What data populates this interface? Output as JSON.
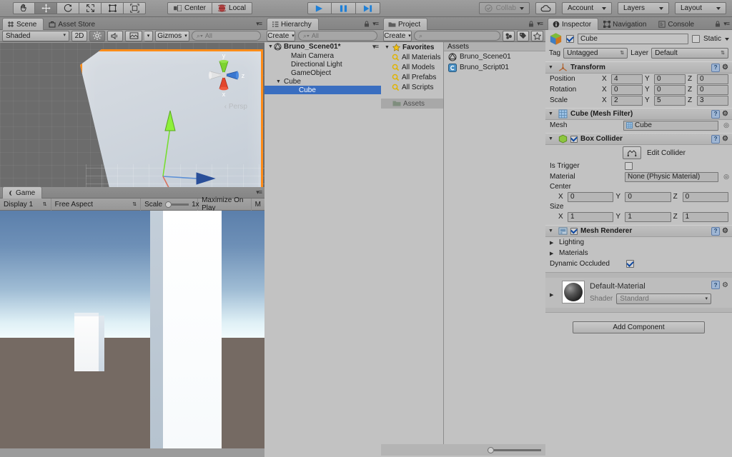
{
  "app": {
    "name": "Unity Editor"
  },
  "toolbar": {
    "tools": [
      {
        "name": "hand-tool",
        "glyph": "✋",
        "active": false
      },
      {
        "name": "move-tool",
        "glyph": "✥",
        "active": true
      },
      {
        "name": "rotate-tool",
        "glyph": "↻",
        "active": false
      },
      {
        "name": "scale-tool",
        "glyph": "⤢",
        "active": false
      },
      {
        "name": "rect-tool",
        "glyph": "□",
        "active": false
      },
      {
        "name": "transform-tool",
        "glyph": "⬚",
        "active": false
      }
    ],
    "pivot_label": "Center",
    "space_label": "Local",
    "play_label": "▶",
    "pause_label": "❙❙",
    "step_label": "▶❙",
    "collab_label": "Collab",
    "cloud_label": "☁",
    "account_label": "Account",
    "layers_label": "Layers",
    "layout_label": "Layout"
  },
  "scene": {
    "tab_label": "Scene",
    "asset_store_tab": "Asset Store",
    "shading_mode": "Shaded",
    "two_d_label": "2D",
    "lighting_icon": "light-icon",
    "audio_icon": "audio-icon",
    "effects_icon": "image-icon",
    "gizmos_label": "Gizmos",
    "search_placeholder": "All",
    "gizmo_axes": {
      "x": "x",
      "y": "y",
      "z": "z"
    },
    "persp_label": "Persp",
    "outline_color": "#ff8c19"
  },
  "game": {
    "tab_label": "Game",
    "display_label": "Display 1",
    "aspect_label": "Free Aspect",
    "scale_label": "Scale",
    "scale_value": "1x",
    "maximize_label": "Maximize On Play",
    "mute_label": "M",
    "sky_top_color": "#5b7fab",
    "ground_color": "#756a63"
  },
  "hierarchy": {
    "tab_label": "Hierarchy",
    "create_label": "Create",
    "search_placeholder": "All",
    "scene_name": "Bruno_Scene01*",
    "items": [
      {
        "label": "Main Camera",
        "depth": 2,
        "foldout": "",
        "selected": false
      },
      {
        "label": "Directional Light",
        "depth": 2,
        "foldout": "",
        "selected": false
      },
      {
        "label": "GameObject",
        "depth": 2,
        "foldout": "",
        "selected": false
      },
      {
        "label": "Cube",
        "depth": 1,
        "foldout": "▼",
        "selected": false
      },
      {
        "label": "Cube",
        "depth": 3,
        "foldout": "",
        "selected": true
      }
    ]
  },
  "project": {
    "tab_label": "Project",
    "create_label": "Create",
    "search_placeholder": "",
    "favorites_label": "Favorites",
    "favorites": [
      {
        "label": "All Materials"
      },
      {
        "label": "All Models"
      },
      {
        "label": "All Prefabs"
      },
      {
        "label": "All Scripts"
      }
    ],
    "assets_tree_label": "Assets",
    "assets_header": "Assets",
    "assets": [
      {
        "label": "Bruno_Scene01",
        "icon": "unity-scene-icon"
      },
      {
        "label": "Bruno_Script01",
        "icon": "csharp-script-icon"
      }
    ]
  },
  "inspector": {
    "tab_label": "Inspector",
    "navigation_tab": "Navigation",
    "console_tab": "Console",
    "object_name": "Cube",
    "object_enabled": true,
    "static_label": "Static",
    "static_checked": false,
    "tag_label": "Tag",
    "tag_value": "Untagged",
    "layer_label": "Layer",
    "layer_value": "Default",
    "transform": {
      "title": "Transform",
      "rows": [
        {
          "label": "Position",
          "x": "4",
          "y": "0",
          "z": "0"
        },
        {
          "label": "Rotation",
          "x": "0",
          "y": "0",
          "z": "0"
        },
        {
          "label": "Scale",
          "x": "2",
          "y": "5",
          "z": "3"
        }
      ]
    },
    "mesh_filter": {
      "title": "Cube (Mesh Filter)",
      "mesh_label": "Mesh",
      "mesh_value": "Cube"
    },
    "box_collider": {
      "title": "Box Collider",
      "enabled": true,
      "edit_collider_label": "Edit Collider",
      "is_trigger_label": "Is Trigger",
      "is_trigger_checked": false,
      "material_label": "Material",
      "material_value": "None (Physic Material)",
      "center_label": "Center",
      "center": {
        "x": "0",
        "y": "0",
        "z": "0"
      },
      "size_label": "Size",
      "size": {
        "x": "1",
        "y": "1",
        "z": "1"
      }
    },
    "mesh_renderer": {
      "title": "Mesh Renderer",
      "enabled": true,
      "lighting_label": "Lighting",
      "materials_label": "Materials",
      "dynamic_occluded_label": "Dynamic Occluded",
      "dynamic_occluded_checked": true
    },
    "material": {
      "title": "Default-Material",
      "shader_label": "Shader",
      "shader_value": "Standard"
    },
    "add_component_label": "Add Component"
  }
}
